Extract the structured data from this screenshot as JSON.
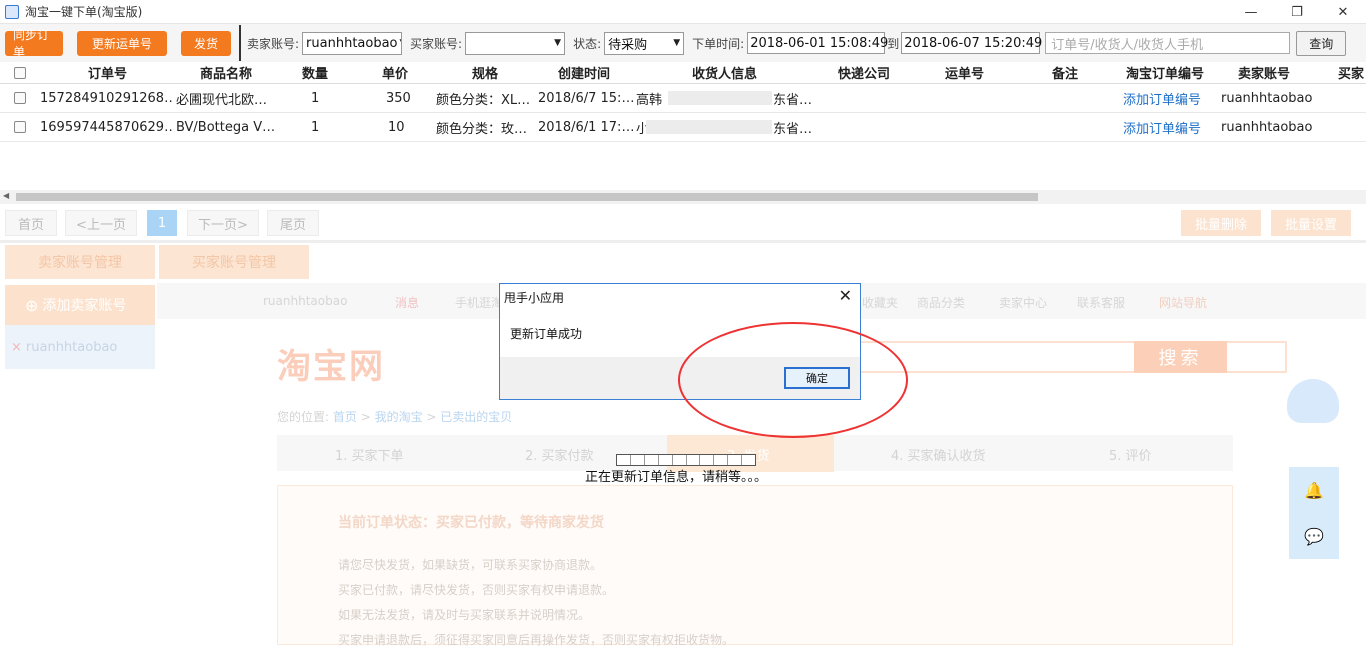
{
  "window": {
    "title": "淘宝一键下单(淘宝版)",
    "minimize": "—",
    "maximize": "❐",
    "close": "✕"
  },
  "toolbar": {
    "sync_orders": "同步订单",
    "update_tracking": "更新运单号",
    "ship": "发货",
    "seller_label": "卖家账号:",
    "seller_value": "ruanhhtaobao",
    "buyer_label": "买家账号:",
    "buyer_value": "",
    "status_label": "状态:",
    "status_value": "待采购",
    "time_label": "下单时间:",
    "date_from": "2018-06-01 15:08:49",
    "to_label": "到",
    "date_to": "2018-06-07 15:20:49",
    "search_placeholder": "订单号/收货人/收货人手机",
    "query": "查询"
  },
  "table": {
    "columns": [
      "订单号",
      "商品名称",
      "数量",
      "单价",
      "规格",
      "创建时间",
      "收货人信息",
      "快递公司",
      "运单号",
      "备注",
      "淘宝订单编号",
      "卖家账号",
      "买家"
    ],
    "rows": [
      {
        "order_no": "157284910291268…",
        "product": "必圃现代北欧…",
        "qty": "1",
        "price": "350",
        "spec": "颜色分类：XL…",
        "created": "2018/6/7 15:…",
        "receiver_a": "高韩",
        "receiver_b": "东省…",
        "express": "",
        "tracking": "",
        "note": "",
        "taobao_no": "添加订单编号",
        "seller": "ruanhhtaobao"
      },
      {
        "order_no": "169597445870629…",
        "product": "BV/Bottega V…",
        "qty": "1",
        "price": "10",
        "spec": "颜色分类：玫…",
        "created": "2018/6/1 17:…",
        "receiver_a": "小",
        "receiver_b": "东省…",
        "express": "",
        "tracking": "",
        "note": "",
        "taobao_no": "添加订单编号",
        "seller": "ruanhhtaobao"
      }
    ]
  },
  "pager": {
    "first": "首页",
    "prev": "<上一页",
    "current": "1",
    "next": "下一页>",
    "last": "尾页",
    "batch_delete": "批量删除",
    "batch_settings": "批量设置"
  },
  "lower": {
    "tab_seller": "卖家账号管理",
    "tab_buyer": "买家账号管理",
    "add_seller": "添加卖家账号",
    "account_item": "ruanhhtaobao",
    "nav": [
      "ruanhhtaobao",
      "消息",
      "手机逛淘宝",
      "收藏夹",
      "商品分类",
      "卖家中心",
      "联系客服",
      "网站导航"
    ],
    "logo": "淘宝网",
    "search_btn": "搜索",
    "crumb_prefix": "您的位置:",
    "crumb_home": "首页",
    "crumb_my": "我的淘宝",
    "crumb_sold": "已卖出的宝贝",
    "steps": [
      "1. 买家下单",
      "2. 买家付款",
      "3. 发货",
      "4. 买家确认收货",
      "5. 评价"
    ],
    "status_title": "当前订单状态：买家已付款，等待商家发货",
    "status_items": [
      "请您尽快发货，如果缺货，可联系买家协商退款。",
      "买家已付款，请尽快发货，否则买家有权申请退款。",
      "如果无法发货，请及时与买家联系并说明情况。",
      "买家申请退款后，须征得买家同意后再操作发货，否则买家有权拒收货物。"
    ]
  },
  "progress": {
    "text": "正在更新订单信息，请稍等。。。"
  },
  "dialog": {
    "title": "甩手小应用",
    "message": "更新订单成功",
    "ok": "确定",
    "close": "✕"
  }
}
